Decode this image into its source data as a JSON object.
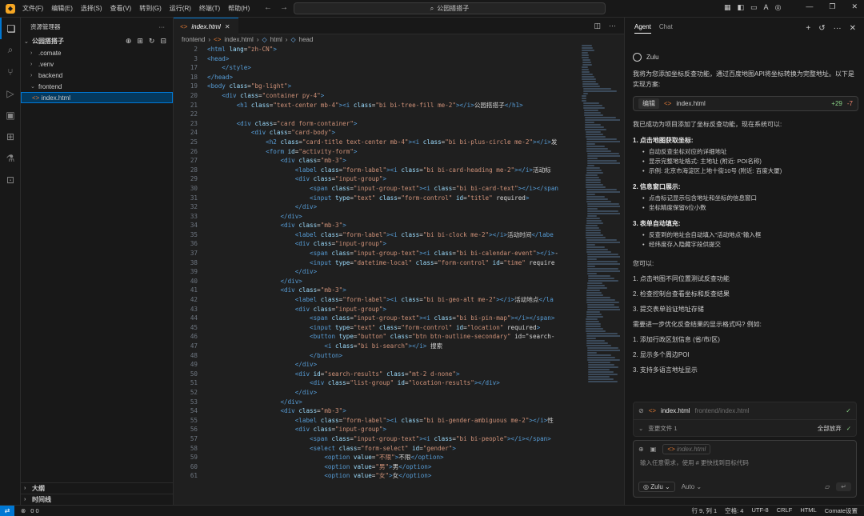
{
  "titlebar": {
    "menu": [
      "文件(F)",
      "编辑(E)",
      "选择(S)",
      "查看(V)",
      "转到(G)",
      "运行(R)",
      "终端(T)",
      "帮助(H)"
    ],
    "search": "公园搭搭子"
  },
  "explorer": {
    "header": "资源管理器",
    "project": "公园搭搭子",
    "items": [
      ".comate",
      ".venv",
      "backend",
      "frontend",
      "index.html"
    ],
    "outline": "大纲",
    "timeline": "时间线"
  },
  "editor": {
    "tab": "index.html",
    "breadcrumb": [
      "frontend",
      "index.html",
      "html",
      "head"
    ],
    "lines": [
      {
        "n": "2",
        "code": "<html lang=\"zh-CN\">"
      },
      {
        "n": "3",
        "code": "<head>"
      },
      {
        "n": "17",
        "code": "    </style>"
      },
      {
        "n": "18",
        "code": "</head>"
      },
      {
        "n": "19",
        "code": "<body class=\"bg-light\">"
      },
      {
        "n": "20",
        "code": "    <div class=\"container py-4\">"
      },
      {
        "n": "21",
        "code": "        <h1 class=\"text-center mb-4\"><i class=\"bi bi-tree-fill me-2\"></i>公园搭搭子</h1>"
      },
      {
        "n": "22",
        "code": ""
      },
      {
        "n": "23",
        "code": "        <div class=\"card form-container\">"
      },
      {
        "n": "24",
        "code": "            <div class=\"card-body\">"
      },
      {
        "n": "25",
        "code": "                <h2 class=\"card-title text-center mb-4\"><i class=\"bi bi-plus-circle me-2\"></i>发"
      },
      {
        "n": "26",
        "code": "                <form id=\"activity-form\">"
      },
      {
        "n": "27",
        "code": "                    <div class=\"mb-3\">"
      },
      {
        "n": "28",
        "code": "                        <label class=\"form-label\"><i class=\"bi bi-card-heading me-2\"></i>活动标"
      },
      {
        "n": "29",
        "code": "                        <div class=\"input-group\">"
      },
      {
        "n": "30",
        "code": "                            <span class=\"input-group-text\"><i class=\"bi bi-card-text\"></i></span"
      },
      {
        "n": "31",
        "code": "                            <input type=\"text\" class=\"form-control\" id=\"title\" required>"
      },
      {
        "n": "32",
        "code": "                        </div>"
      },
      {
        "n": "33",
        "code": "                    </div>"
      },
      {
        "n": "34",
        "code": "                    <div class=\"mb-3\">"
      },
      {
        "n": "35",
        "code": "                        <label class=\"form-label\"><i class=\"bi bi-clock me-2\"></i>活动时间</labe"
      },
      {
        "n": "36",
        "code": "                        <div class=\"input-group\">"
      },
      {
        "n": "37",
        "code": "                            <span class=\"input-group-text\"><i class=\"bi bi-calendar-event\"></i>-"
      },
      {
        "n": "38",
        "code": "                            <input type=\"datetime-local\" class=\"form-control\" id=\"time\" require"
      },
      {
        "n": "39",
        "code": "                        </div>"
      },
      {
        "n": "40",
        "code": "                    </div>"
      },
      {
        "n": "41",
        "code": "                    <div class=\"mb-3\">"
      },
      {
        "n": "42",
        "code": "                        <label class=\"form-label\"><i class=\"bi bi-geo-alt me-2\"></i>活动地点</la"
      },
      {
        "n": "43",
        "code": "                        <div class=\"input-group\">"
      },
      {
        "n": "44",
        "code": "                            <span class=\"input-group-text\"><i class=\"bi bi-pin-map\"></i></span>"
      },
      {
        "n": "45",
        "code": "                            <input type=\"text\" class=\"form-control\" id=\"location\" required>"
      },
      {
        "n": "46",
        "code": "                            <button type=\"button\" class=\"btn btn-outline-secondary\" id=\"search-"
      },
      {
        "n": "47",
        "code": "                                <i class=\"bi bi-search\"></i> 搜索"
      },
      {
        "n": "48",
        "code": "                            </button>"
      },
      {
        "n": "49",
        "code": "                        </div>"
      },
      {
        "n": "50",
        "code": "                        <div id=\"search-results\" class=\"mt-2 d-none\">"
      },
      {
        "n": "51",
        "code": "                            <div class=\"list-group\" id=\"location-results\"></div>"
      },
      {
        "n": "52",
        "code": "                        </div>"
      },
      {
        "n": "53",
        "code": "                    </div>"
      },
      {
        "n": "54",
        "code": "                    <div class=\"mb-3\">"
      },
      {
        "n": "55",
        "code": "                        <label class=\"form-label\"><i class=\"bi bi-gender-ambiguous me-2\"></i>性"
      },
      {
        "n": "56",
        "code": "                        <div class=\"input-group\">"
      },
      {
        "n": "57",
        "code": "                            <span class=\"input-group-text\"><i class=\"bi bi-people\"></i></span>"
      },
      {
        "n": "58",
        "code": "                            <select class=\"form-select\" id=\"gender\">"
      },
      {
        "n": "59",
        "code": "                                <option value=\"不限\">不限</option>"
      },
      {
        "n": "60",
        "code": "                                <option value=\"男\">男</option>"
      },
      {
        "n": "61",
        "code": "                                <option value=\"女\">女</option>"
      }
    ]
  },
  "agent": {
    "tabs": [
      "Agent",
      "Chat"
    ],
    "author": "Zulu",
    "intro": "我将为您添加坐标反查功能，通过百度地图API将坐标转换为完整地址。以下是实现方案:",
    "card": {
      "tag": "编辑",
      "file": "index.html",
      "plus": "+29",
      "minus": "-7"
    },
    "done": "我已成功为项目添加了坐标反查功能，现在系统可以:",
    "sections": [
      {
        "title": "1. 点击地图获取坐标:",
        "items": [
          "自动反查坐标对应的详细地址",
          "显示完整地址格式: 主地址 (附近: POI名称)",
          "示例: 北京市海淀区上地十街10号 (附近: 百度大厦)"
        ]
      },
      {
        "title": "2. 信息窗口展示:",
        "items": [
          "点击标记显示包含地址和坐标的信息窗口",
          "坐标精度保留6位小数"
        ]
      },
      {
        "title": "3. 表单自动填充:",
        "items": [
          "反查到的地址会自动填入\"活动地点\"输入框",
          "经纬度存入隐藏字段供提交"
        ]
      }
    ],
    "can": "您可以:",
    "steps": [
      "1. 点击地图不同位置测试反查功能",
      "2. 检查控制台查看坐标和反查结果",
      "3. 提交表单验证地址存储"
    ],
    "question": "需要进一步优化反查结果的显示格式吗? 例如:",
    "options": [
      "1. 添加行政区划信息 (省/市/区)",
      "2. 显示多个周边POI",
      "3. 支持多语言地址显示"
    ],
    "changes": {
      "file": "index.html",
      "path": "frontend/index.html",
      "changed": "变更文件 1",
      "discard": "全部放弃"
    },
    "input": {
      "chip": "index.html",
      "placeholder": "输入任意需求，使用 # 更快找到目标代码",
      "model": "Zulu",
      "mode": "Auto"
    }
  },
  "statusbar": {
    "problems": "0  0",
    "position": "行 9, 列 1",
    "spaces": "空格: 4",
    "encoding": "UTF-8",
    "eol": "CRLF",
    "lang": "HTML",
    "settings": "Comate设置"
  },
  "colors": {
    "accent": "#0078d4",
    "bg": "#1e1e1e",
    "tag": "#569cd6",
    "attr": "#9cdcfe",
    "str": "#ce9178"
  }
}
